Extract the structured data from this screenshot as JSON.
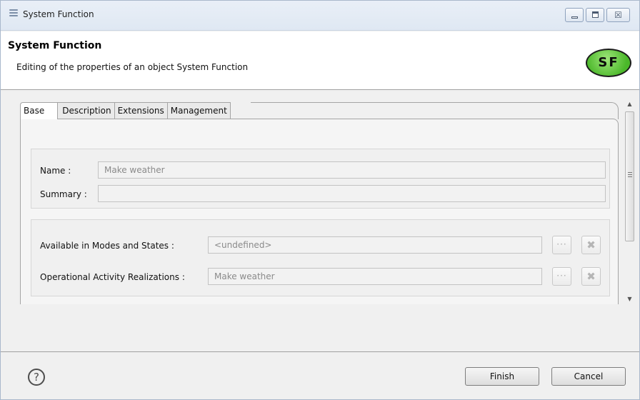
{
  "window": {
    "title": "System Function",
    "icon": "hamburger-icon",
    "controls": {
      "minimize": "minimize-icon",
      "maximize": "maximize-icon",
      "close": "close-icon",
      "close_glyph": "☒"
    }
  },
  "header": {
    "title": "System Function",
    "subtitle": "Editing of the properties of an object System Function",
    "badge": "SF",
    "badge_color": "#4bb82a"
  },
  "tabs": [
    {
      "label": "Base",
      "active": true
    },
    {
      "label": "Description",
      "active": false
    },
    {
      "label": "Extensions",
      "active": false
    },
    {
      "label": "Management",
      "active": false
    }
  ],
  "base": {
    "name_label": "Name :",
    "name_value": "Make weather",
    "summary_label": "Summary :",
    "summary_value": "",
    "modes_label": "Available in Modes and States :",
    "modes_value": "<undefined>",
    "activity_label": "Operational Activity Realizations :",
    "activity_value": "Make weather",
    "browse_glyph": "···",
    "clear_glyph": "✖"
  },
  "footer": {
    "help_glyph": "?",
    "finish_label": "Finish",
    "cancel_label": "Cancel"
  }
}
